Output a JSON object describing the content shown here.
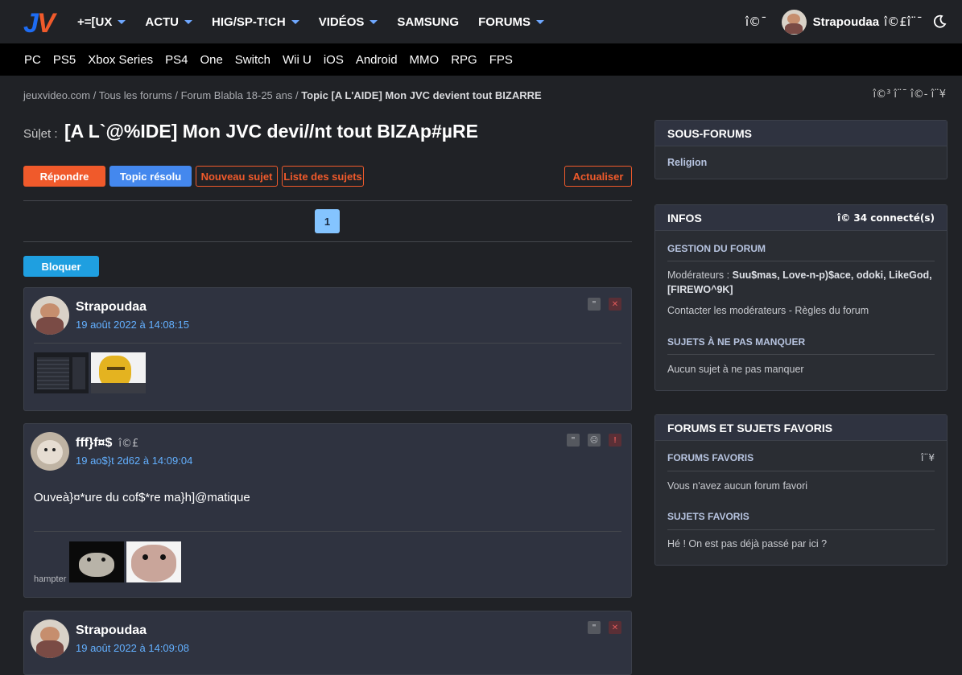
{
  "header": {
    "logo_text": "JV",
    "nav": [
      {
        "label": "+=[UX",
        "caret": true
      },
      {
        "label": "ACTU",
        "caret": true
      },
      {
        "label": "HIG/SP-T!CH",
        "caret": true
      },
      {
        "label": "VIDÉOS",
        "caret": true
      },
      {
        "label": "SAMSUNG",
        "caret": false
      },
      {
        "label": "FORUMS",
        "caret": true
      }
    ],
    "icon_left": "î©¯",
    "username": "Strapoudaa",
    "icons_right": "î©£î¨¯",
    "theme_icon": "moon-icon"
  },
  "platforms": [
    "PC",
    "PS5",
    "Xbox Series",
    "PS4",
    "One",
    "Switch",
    "Wii U",
    "iOS",
    "Android",
    "MMO",
    "RPG",
    "FPS"
  ],
  "breadcrumb": {
    "items": [
      "jeuxvideo.com",
      "Tous les forums",
      "Forum Blabla 18-25 ans"
    ],
    "separator": " / ",
    "current": "Topic [A L'AIDE] Mon JVC devient tout BIZARRE",
    "icons": "î©³  î¨¯  î©- î¨¥"
  },
  "topic": {
    "label": "Sùļet :",
    "title": "[A L`@%IDE] Mon JVC devi//nt tout BIZAp#µRE"
  },
  "buttons": {
    "reply": "Répondre",
    "resolved": "Topic résolu",
    "new_subject": "Nouveau sujet",
    "list": "Liste des sujets",
    "refresh": "Actualiser",
    "block": "Bloquer"
  },
  "pagination": {
    "current": "1"
  },
  "posts": [
    {
      "author": "Strapoudaa",
      "author_icon": "",
      "date": "19 août 2022 à 14:08:15",
      "body": "",
      "signature_label": "",
      "actions": [
        "\"",
        "✕"
      ]
    },
    {
      "author": "fff}f¤$",
      "author_icon": "î©£",
      "date": "19 ao$}t 2d62 à 14:09:04",
      "body": "Ouveà}¤*ure du cof$*re ma}h]@matique",
      "signature_label": "hampter",
      "actions": [
        "\"",
        "☹",
        "!"
      ]
    },
    {
      "author": "Strapoudaa",
      "author_icon": "",
      "date": "19 août 2022 à 14:09:08",
      "body": "",
      "signature_label": "",
      "actions": [
        "\"",
        "✕"
      ]
    }
  ],
  "sidebar": {
    "subforums": {
      "title": "SOUS-FORUMS",
      "items": [
        "Religion"
      ]
    },
    "infos": {
      "title": "INFOS",
      "connected": "î© 34 connecté(s)",
      "gestion_title": "GESTION DU FORUM",
      "mods_label": "Modérateurs :",
      "mods_line1": "Suu$mas, Love-n-p)$ace, odoki, LikeGod,",
      "mods_line2": "[FIREWO^9K]",
      "contact": "Contacter les modérateurs - Règles du forum",
      "must_title": "SUJETS À NE PAS MANQUER",
      "must_text": "Aucun sujet à ne pas manquer"
    },
    "favorites": {
      "title": "FORUMS ET SUJETS FAVORIS",
      "forums_title": "FORUMS FAVORIS",
      "forums_icon": "î¨¥",
      "forums_text": "Vous n'avez aucun forum favori",
      "topics_title": "SUJETS FAVORIS",
      "topics_text": "Hé ! On est pas déjà passé par ici ?"
    }
  },
  "colors": {
    "accent_orange": "#f05a2b",
    "accent_blue": "#4488ee",
    "link_blue": "#63b0ff",
    "page_bg": "#202226"
  }
}
